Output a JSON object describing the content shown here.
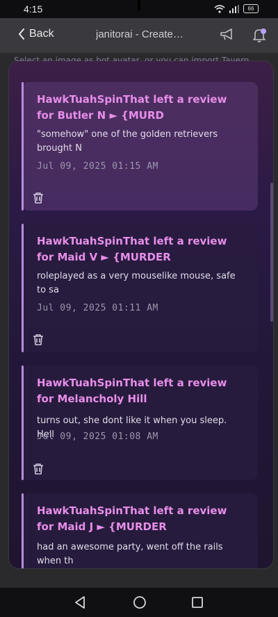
{
  "status": {
    "time": "4:15",
    "battery": "66"
  },
  "header": {
    "back_label": "Back",
    "title": "janitorai - Create…"
  },
  "background": {
    "hint_text": "Select an image as bot avatar, or you can import Tavern"
  },
  "notifications": [
    {
      "title": "HawkTuahSpinThat left a review for Butler N ► {MURD",
      "body": "\"somehow\" one of the golden retrievers brought N",
      "date": "Jul 09, 2025 01:15 AM"
    },
    {
      "title": "HawkTuahSpinThat left a review for Maid V ► {MURDER",
      "body": "roleplayed as a very mouselike mouse, safe to sa",
      "date": "Jul 09, 2025 01:11 AM"
    },
    {
      "title": "HawkTuahSpinThat left a review for Melancholy Hill",
      "body": "turns out, she dont like it when you sleep. Hell",
      "date": "Jul 09, 2025 01:08 AM"
    },
    {
      "title": "HawkTuahSpinThat left a review for Maid J ► {MURDER",
      "body": "had an awesome party, went off the rails when th",
      "date": ""
    }
  ],
  "colors": {
    "accent": "#e78ee8",
    "panel_bg": "#2a1a45",
    "date_text": "#9e96ad"
  }
}
